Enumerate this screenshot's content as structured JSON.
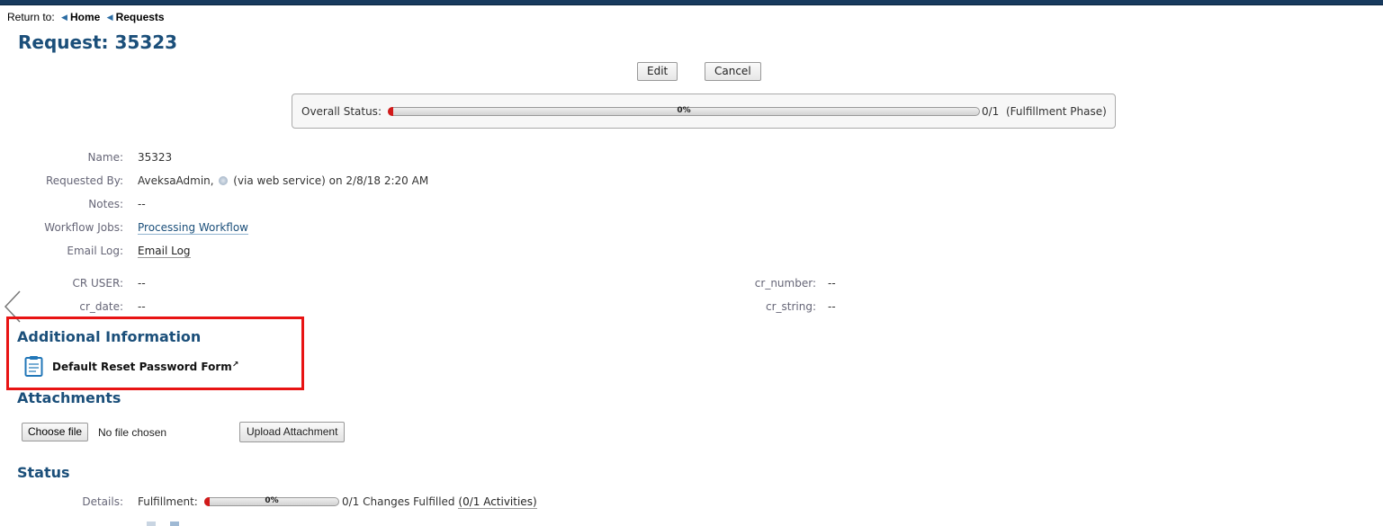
{
  "breadcrumb": {
    "prefix": "Return to:",
    "items": [
      "Home",
      "Requests"
    ]
  },
  "page_title": "Request: 35323",
  "toolbar": {
    "edit_label": "Edit",
    "cancel_label": "Cancel"
  },
  "overall_status": {
    "label": "Overall Status:",
    "percent_text": "0%",
    "progress_fraction": 0.0,
    "count_text": "0/1",
    "phase_text": "(Fulfillment Phase)"
  },
  "details": {
    "name": {
      "label": "Name:",
      "value": "35323"
    },
    "requested_by": {
      "label": "Requested By:",
      "user": "AveksaAdmin,",
      "suffix": "(via web service) on 2/8/18 2:20 AM"
    },
    "notes": {
      "label": "Notes:",
      "value": "--"
    },
    "workflow_jobs": {
      "label": "Workflow Jobs:",
      "value": "Processing Workflow"
    },
    "email_log": {
      "label": "Email Log:",
      "value": "Email Log"
    }
  },
  "custom_attributes": {
    "cr_user": {
      "label": "CR USER:",
      "value": "--"
    },
    "cr_date": {
      "label": "cr_date:",
      "value": "--"
    },
    "cr_number": {
      "label": "cr_number:",
      "value": "--"
    },
    "cr_string": {
      "label": "cr_string:",
      "value": "--"
    }
  },
  "additional_information": {
    "title": "Additional Information",
    "form_link": "Default Reset Password Form"
  },
  "attachments": {
    "title": "Attachments",
    "choose_file_label": "Choose file",
    "file_status": "No file chosen",
    "upload_label": "Upload Attachment"
  },
  "status": {
    "title": "Status",
    "details_label": "Details:",
    "fulfillment_label": "Fulfillment:",
    "percent_text": "0%",
    "progress_fraction": 0.0,
    "changes_text": "0/1 Changes Fulfilled",
    "activities_link": "(0/1 Activities)"
  },
  "colors": {
    "heading": "#1b4f7a",
    "highlight": "#e81313",
    "progress_fill": "#d21a1a",
    "top_bar": "#173a5e"
  }
}
